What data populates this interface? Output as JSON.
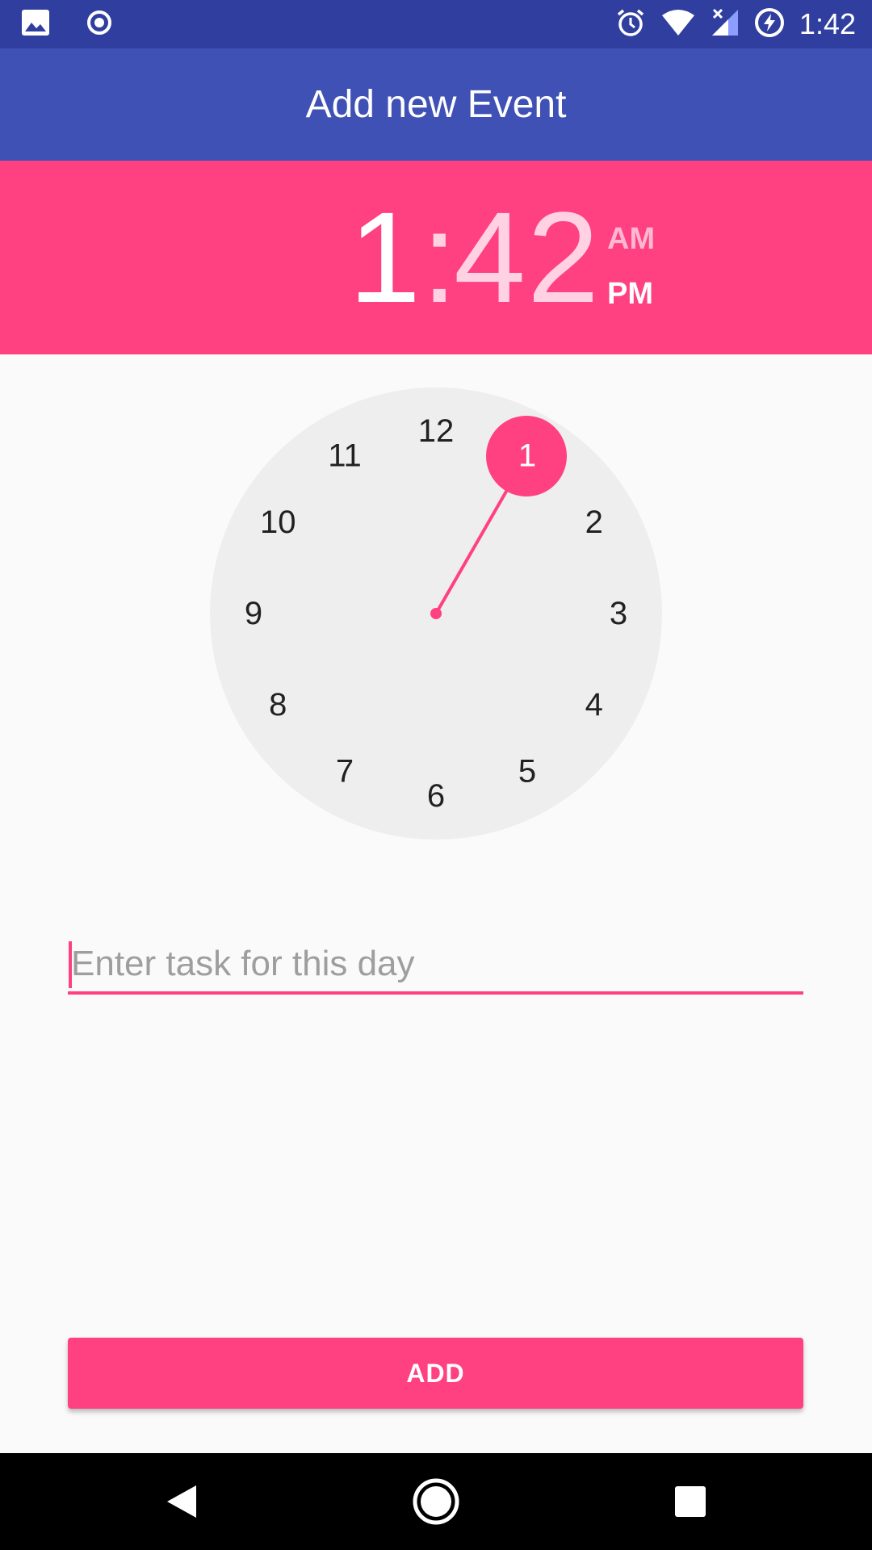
{
  "status_bar": {
    "time": "1:42",
    "icons": [
      "image-icon",
      "record-icon",
      "alarm-icon",
      "wifi-icon",
      "signal-icon",
      "battery-charging-icon"
    ]
  },
  "app_bar": {
    "title": "Add new Event"
  },
  "time_picker": {
    "hour": "1",
    "separator": ":",
    "minute": "42",
    "am_label": "AM",
    "pm_label": "PM",
    "selected_period": "PM",
    "selected_hour": "1",
    "dial_numbers": [
      "12",
      "1",
      "2",
      "3",
      "4",
      "5",
      "6",
      "7",
      "8",
      "9",
      "10",
      "11"
    ]
  },
  "task_input": {
    "value": "",
    "placeholder": "Enter task for this day"
  },
  "actions": {
    "add_label": "ADD"
  },
  "colors": {
    "status_bar": "#303f9f",
    "app_bar": "#3f51b5",
    "accent": "#ff4081",
    "dial_face": "#eeeeee",
    "background": "#fafafa"
  },
  "nav_bar": {
    "icons": [
      "back-icon",
      "home-icon",
      "recents-icon"
    ]
  }
}
